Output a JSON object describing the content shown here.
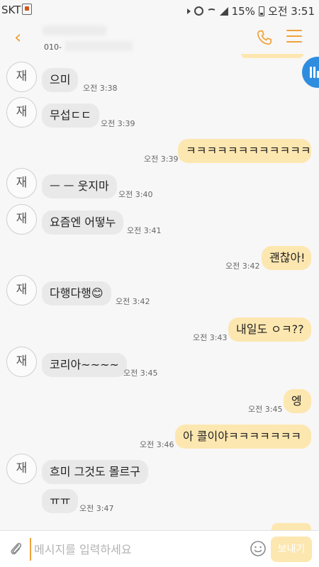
{
  "status_bar": {
    "carrier": "SKT",
    "battery": "15%",
    "time": "오전 3:51"
  },
  "header": {
    "phone_prefix": "010-"
  },
  "avatar_label": "재",
  "messages": [
    {
      "side": "in",
      "avatar": true,
      "text": "으미",
      "time": "오전 3:38"
    },
    {
      "side": "in",
      "avatar": true,
      "text": "무섭ㄷㄷ",
      "time": "오전 3:39"
    },
    {
      "side": "out",
      "avatar": false,
      "text": "ㅋㅋㅋㅋㅋㅋㅋㅋㅋㅋㅋㅋ",
      "time": "오전 3:39"
    },
    {
      "side": "in",
      "avatar": true,
      "text": "ㅡ ㅡ 웃지마",
      "time": "오전 3:40"
    },
    {
      "side": "in",
      "avatar": true,
      "text": "요즘엔 어떻누",
      "time": "오전 3:41"
    },
    {
      "side": "out",
      "avatar": false,
      "text": "괜찮아!",
      "time": "오전 3:42"
    },
    {
      "side": "in",
      "avatar": true,
      "text": "다행다행😊",
      "time": "오전 3:42"
    },
    {
      "side": "out",
      "avatar": false,
      "text": "내일도 ㅇㅋ??",
      "time": "오전 3:43"
    },
    {
      "side": "in",
      "avatar": true,
      "text": "코리아~~~~",
      "time": "오전 3:45"
    },
    {
      "side": "out",
      "avatar": false,
      "text": "엥",
      "time": "오전 3:45"
    },
    {
      "side": "out",
      "avatar": false,
      "text": "아 콜이야ㅋㅋㅋㅋㅋㅋㅋ",
      "time": "오전 3:46"
    },
    {
      "side": "in",
      "avatar": true,
      "text": "흐미 그것도 몰르구",
      "time": ""
    },
    {
      "side": "in",
      "avatar": false,
      "text": "ㅠㅠ",
      "time": "오전 3:47"
    }
  ],
  "input": {
    "placeholder": "메시지를 입력하세요",
    "value": "",
    "send_label": "보내기"
  },
  "colors": {
    "accent": "#f0a23a",
    "outgoing_bubble": "#fde7b0",
    "incoming_bubble": "#e9e9e9",
    "floating_button": "#2f8de0"
  },
  "icons": [
    "back-arrow-icon",
    "phone-icon",
    "menu-icon",
    "attach-clip-icon",
    "emoji-icon"
  ]
}
